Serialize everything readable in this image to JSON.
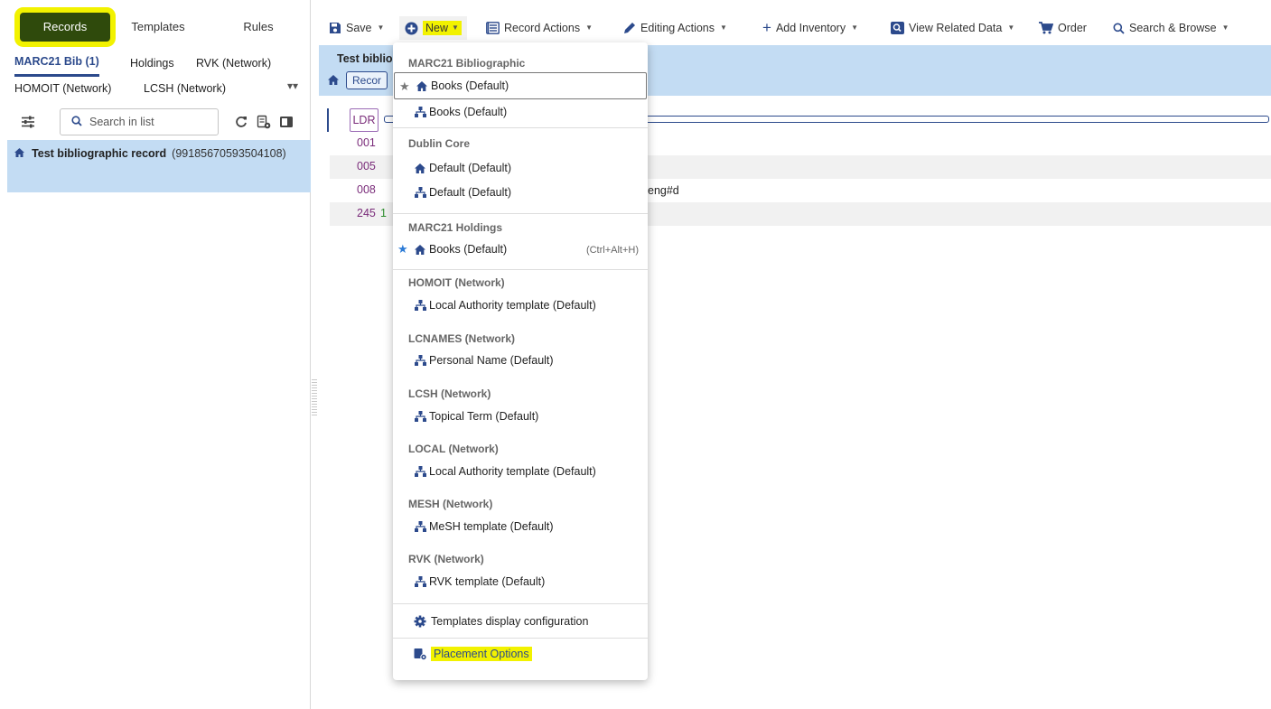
{
  "top_tabs": [
    "Records",
    "Templates",
    "Rules"
  ],
  "sub_tabs": [
    "MARC21 Bib (1)",
    "Holdings",
    "RVK (Network)",
    "HOMOIT (Network)",
    "LCSH (Network)"
  ],
  "search": {
    "placeholder": "Search in list"
  },
  "list": [
    {
      "title": "Test bibliographic record",
      "id": "(99185670593504108)"
    }
  ],
  "toolbar": {
    "save": "Save",
    "new": "New",
    "record_actions": "Record Actions",
    "editing_actions": "Editing Actions",
    "add_inventory": "Add Inventory",
    "view_related": "View Related Data",
    "order": "Order",
    "search_browse": "Search & Browse"
  },
  "record": {
    "title": "Test biblio",
    "chip": "Recor",
    "rows": [
      {
        "tag": "LDR",
        "ind": ""
      },
      {
        "tag": "001",
        "ind": ""
      },
      {
        "tag": "005",
        "ind": ""
      },
      {
        "tag": "008",
        "ind": ""
      },
      {
        "tag": "245",
        "ind": "1"
      }
    ],
    "field_008_text": "eng#d"
  },
  "menu": {
    "sections": [
      "MARC21 Bibliographic",
      "Dublin Core",
      "MARC21 Holdings",
      "HOMOIT (Network)",
      "LCNAMES (Network)",
      "LCSH (Network)",
      "LOCAL (Network)",
      "MESH (Network)",
      "RVK (Network)"
    ],
    "items": [
      "Books (Default)",
      "Books (Default)",
      "Default (Default)",
      "Default (Default)",
      "Books (Default)",
      "Local Authority template (Default)",
      "Personal Name (Default)",
      "Topical Term (Default)",
      "Local Authority template (Default)",
      "MeSH template (Default)",
      "RVK template (Default)"
    ],
    "shortcut": "(Ctrl+Alt+H)",
    "templates_config": "Templates display configuration",
    "placement": "Placement Options"
  },
  "colors": {
    "records_tab_bg": "#2f4a0c",
    "highlight": "#f2f200",
    "selected_row": "#c3dcf3",
    "accent": "#2c4a8c"
  }
}
